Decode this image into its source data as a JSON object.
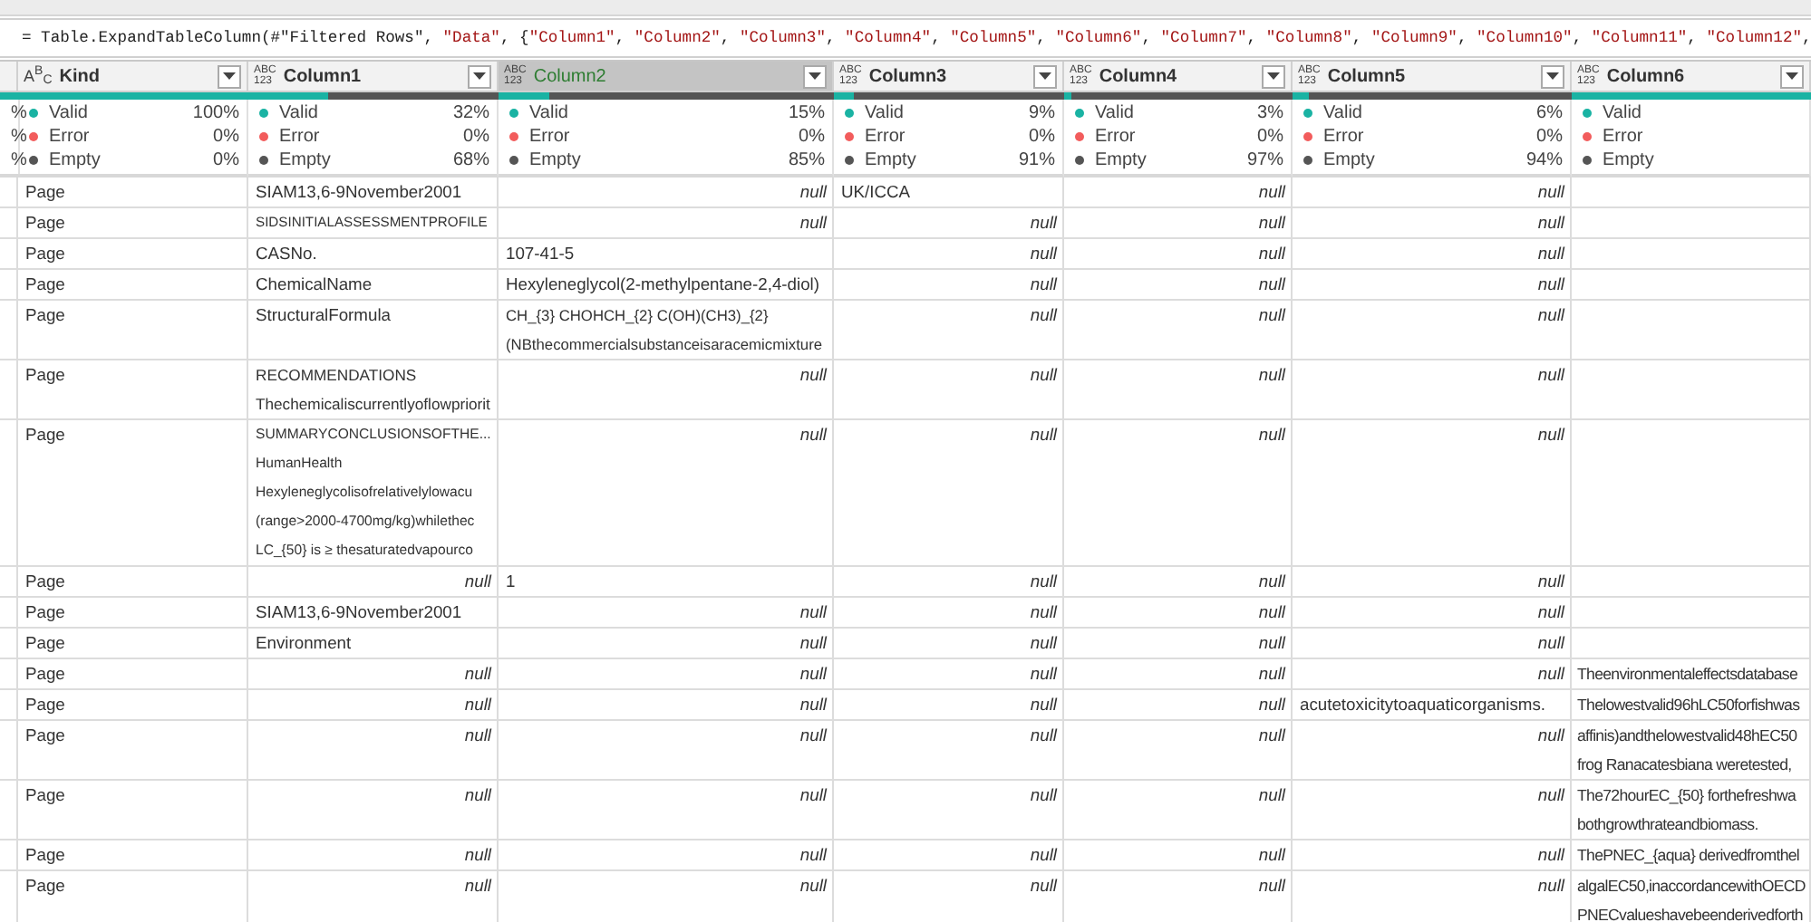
{
  "formula_bar": {
    "tokens": [
      {
        "text": "= Table.ExpandTableColumn(#\"Filtered Rows\", ",
        "kind": "code"
      },
      {
        "text": "\"Data\"",
        "kind": "string"
      },
      {
        "text": ", {",
        "kind": "code"
      },
      {
        "text": "\"Column1\"",
        "kind": "string"
      },
      {
        "text": ", ",
        "kind": "code"
      },
      {
        "text": "\"Column2\"",
        "kind": "string"
      },
      {
        "text": ", ",
        "kind": "code"
      },
      {
        "text": "\"Column3\"",
        "kind": "string"
      },
      {
        "text": ", ",
        "kind": "code"
      },
      {
        "text": "\"Column4\"",
        "kind": "string"
      },
      {
        "text": ", ",
        "kind": "code"
      },
      {
        "text": "\"Column5\"",
        "kind": "string"
      },
      {
        "text": ", ",
        "kind": "code"
      },
      {
        "text": "\"Column6\"",
        "kind": "string"
      },
      {
        "text": ", ",
        "kind": "code"
      },
      {
        "text": "\"Column7\"",
        "kind": "string"
      },
      {
        "text": ", ",
        "kind": "code"
      },
      {
        "text": "\"Column8\"",
        "kind": "string"
      },
      {
        "text": ", ",
        "kind": "code"
      },
      {
        "text": "\"Column9\"",
        "kind": "string"
      },
      {
        "text": ", ",
        "kind": "code"
      },
      {
        "text": "\"Column10\"",
        "kind": "string"
      },
      {
        "text": ", ",
        "kind": "code"
      },
      {
        "text": "\"Column11\"",
        "kind": "string"
      },
      {
        "text": ", ",
        "kind": "code"
      },
      {
        "text": "\"Column12\"",
        "kind": "string"
      },
      {
        "text": ",",
        "kind": "code"
      }
    ]
  },
  "columns": [
    {
      "kind": "stub",
      "level": 1,
      "stats": [
        {
          "value": "%"
        },
        {
          "value": "%"
        },
        {
          "value": "%"
        }
      ]
    },
    {
      "kind": "column",
      "name": "Kind",
      "type_label": [
        "A",
        "B",
        "C"
      ],
      "selected": false,
      "level": 1,
      "stats": [
        {
          "label": "Valid",
          "value": "100%",
          "color": "#1ab3a3"
        },
        {
          "label": "Error",
          "value": "0%",
          "color": "#f25c5c"
        },
        {
          "label": "Empty",
          "value": "0%",
          "color": "#555555"
        }
      ]
    },
    {
      "kind": "column",
      "name": "Column1",
      "type_label": [
        "ABC",
        "123"
      ],
      "selected": false,
      "level": 0.32,
      "stats": [
        {
          "label": "Valid",
          "value": "32%",
          "color": "#1ab3a3"
        },
        {
          "label": "Error",
          "value": "0%",
          "color": "#f25c5c"
        },
        {
          "label": "Empty",
          "value": "68%",
          "color": "#555555"
        }
      ]
    },
    {
      "kind": "column",
      "name": "Column2",
      "type_label": [
        "ABC",
        "123"
      ],
      "selected": true,
      "level": 0.15,
      "stats": [
        {
          "label": "Valid",
          "value": "15%",
          "color": "#1ab3a3"
        },
        {
          "label": "Error",
          "value": "0%",
          "color": "#f25c5c"
        },
        {
          "label": "Empty",
          "value": "85%",
          "color": "#555555"
        }
      ]
    },
    {
      "kind": "column",
      "name": "Column3",
      "type_label": [
        "ABC",
        "123"
      ],
      "selected": false,
      "level": 0.09,
      "stats": [
        {
          "label": "Valid",
          "value": "9%",
          "color": "#1ab3a3"
        },
        {
          "label": "Error",
          "value": "0%",
          "color": "#f25c5c"
        },
        {
          "label": "Empty",
          "value": "91%",
          "color": "#555555"
        }
      ]
    },
    {
      "kind": "column",
      "name": "Column4",
      "type_label": [
        "ABC",
        "123"
      ],
      "selected": false,
      "level": 0.03,
      "stats": [
        {
          "label": "Valid",
          "value": "3%",
          "color": "#1ab3a3"
        },
        {
          "label": "Error",
          "value": "0%",
          "color": "#f25c5c"
        },
        {
          "label": "Empty",
          "value": "97%",
          "color": "#555555"
        }
      ]
    },
    {
      "kind": "column",
      "name": "Column5",
      "type_label": [
        "ABC",
        "123"
      ],
      "selected": false,
      "level": 0.06,
      "stats": [
        {
          "label": "Valid",
          "value": "6%",
          "color": "#1ab3a3"
        },
        {
          "label": "Error",
          "value": "0%",
          "color": "#f25c5c"
        },
        {
          "label": "Empty",
          "value": "94%",
          "color": "#555555"
        }
      ]
    },
    {
      "kind": "column",
      "name": "Column6",
      "type_label": [
        "ABC",
        "123"
      ],
      "selected": false,
      "level": 1,
      "stats": [
        {
          "label": "Valid",
          "color": "#1ab3a3"
        },
        {
          "label": "Error",
          "color": "#f25c5c"
        },
        {
          "label": "Empty",
          "color": "#555555"
        }
      ]
    }
  ],
  "rows": [
    {
      "cells": [
        "Page",
        "SIAM13,6-9November2001",
        {
          "text": "null",
          "kind": "null"
        },
        "UK/ICCA",
        {
          "text": "null",
          "kind": "null"
        },
        {
          "text": "null",
          "kind": "null"
        },
        null
      ]
    },
    {
      "cells": [
        "Page",
        "SIDSINITIALASSESSMENTPROFILE",
        {
          "text": "null",
          "kind": "null"
        },
        {
          "text": "null",
          "kind": "null"
        },
        {
          "text": "null",
          "kind": "null"
        },
        {
          "text": "null",
          "kind": "null"
        },
        null
      ]
    },
    {
      "cells": [
        "Page",
        "CASNo.",
        "107-41-5",
        {
          "text": "null",
          "kind": "null"
        },
        {
          "text": "null",
          "kind": "null"
        },
        {
          "text": "null",
          "kind": "null"
        },
        null
      ]
    },
    {
      "cells": [
        "Page",
        "ChemicalName",
        "Hexyleneglycol(2-methylpentane-2,4-diol)",
        {
          "text": "null",
          "kind": "null"
        },
        {
          "text": "null",
          "kind": "null"
        },
        {
          "text": "null",
          "kind": "null"
        },
        null
      ]
    },
    {
      "cells": [
        "Page",
        "StructuralFormula",
        "CH_{3} CHOHCH_{2} C(OH)(CH3)_{2}\n(NBthecommercialsubstanceisaracemicmixture",
        {
          "text": "null",
          "kind": "null"
        },
        {
          "text": "null",
          "kind": "null"
        },
        {
          "text": "null",
          "kind": "null"
        },
        null
      ]
    },
    {
      "cells": [
        "Page",
        "RECOMMENDATIONS\nThechemicaliscurrentlyoflowpriorit",
        {
          "text": "null",
          "kind": "null"
        },
        {
          "text": "null",
          "kind": "null"
        },
        {
          "text": "null",
          "kind": "null"
        },
        {
          "text": "null",
          "kind": "null"
        },
        null
      ]
    },
    {
      "cells": [
        "Page",
        "SUMMARYCONCLUSIONSOFTHE...\nHumanHealth\nHexyleneglycolisofrelativelylowacu\n(range>2000-4700mg/kg)whilethec\nLC_{50} is ≥ thesaturatedvapourco",
        {
          "text": "null",
          "kind": "null"
        },
        {
          "text": "null",
          "kind": "null"
        },
        {
          "text": "null",
          "kind": "null"
        },
        {
          "text": "null",
          "kind": "null"
        },
        null
      ]
    },
    {
      "cells": [
        "Page",
        {
          "text": "null",
          "kind": "null"
        },
        "1",
        {
          "text": "null",
          "kind": "null"
        },
        {
          "text": "null",
          "kind": "null"
        },
        {
          "text": "null",
          "kind": "null"
        },
        null
      ]
    },
    {
      "cells": [
        "Page",
        "SIAM13,6-9November2001",
        {
          "text": "null",
          "kind": "null"
        },
        {
          "text": "null",
          "kind": "null"
        },
        {
          "text": "null",
          "kind": "null"
        },
        {
          "text": "null",
          "kind": "null"
        },
        null
      ]
    },
    {
      "cells": [
        "Page",
        "Environment",
        {
          "text": "null",
          "kind": "null"
        },
        {
          "text": "null",
          "kind": "null"
        },
        {
          "text": "null",
          "kind": "null"
        },
        {
          "text": "null",
          "kind": "null"
        },
        null
      ]
    },
    {
      "cells": [
        "Page",
        {
          "text": "null",
          "kind": "null"
        },
        {
          "text": "null",
          "kind": "null"
        },
        {
          "text": "null",
          "kind": "null"
        },
        {
          "text": "null",
          "kind": "null"
        },
        {
          "text": "null",
          "kind": "null"
        },
        "Theenvironmentaleffectsdatabase"
      ]
    },
    {
      "cells": [
        "Page",
        {
          "text": "null",
          "kind": "null"
        },
        {
          "text": "null",
          "kind": "null"
        },
        {
          "text": "null",
          "kind": "null"
        },
        {
          "text": "null",
          "kind": "null"
        },
        "acutetoxicitytoaquaticorganisms.",
        "Thelowestvalid96hLC50forfishwas"
      ]
    },
    {
      "cells": [
        "Page",
        {
          "text": "null",
          "kind": "null"
        },
        {
          "text": "null",
          "kind": "null"
        },
        {
          "text": "null",
          "kind": "null"
        },
        {
          "text": "null",
          "kind": "null"
        },
        {
          "text": "null",
          "kind": "null"
        },
        "affinis)andthelowestvalid48hEC50\nfrog Ranacatesbiana weretested,"
      ]
    },
    {
      "cells": [
        "Page",
        {
          "text": "null",
          "kind": "null"
        },
        {
          "text": "null",
          "kind": "null"
        },
        {
          "text": "null",
          "kind": "null"
        },
        {
          "text": "null",
          "kind": "null"
        },
        {
          "text": "null",
          "kind": "null"
        },
        "The72hourEC_{50} forthefreshwa\nbothgrowthrateandbiomass."
      ]
    },
    {
      "cells": [
        "Page",
        {
          "text": "null",
          "kind": "null"
        },
        {
          "text": "null",
          "kind": "null"
        },
        {
          "text": "null",
          "kind": "null"
        },
        {
          "text": "null",
          "kind": "null"
        },
        {
          "text": "null",
          "kind": "null"
        },
        "ThePNEC_{aqua} derivedfromthel"
      ]
    },
    {
      "cells": [
        "Page",
        {
          "text": "null",
          "kind": "null"
        },
        {
          "text": "null",
          "kind": "null"
        },
        {
          "text": "null",
          "kind": "null"
        },
        {
          "text": "null",
          "kind": "null"
        },
        {
          "text": "null",
          "kind": "null"
        },
        "algalEC50,inaccordancewithOECD\nPNECvalueshavebeenderivedforth"
      ]
    }
  ]
}
